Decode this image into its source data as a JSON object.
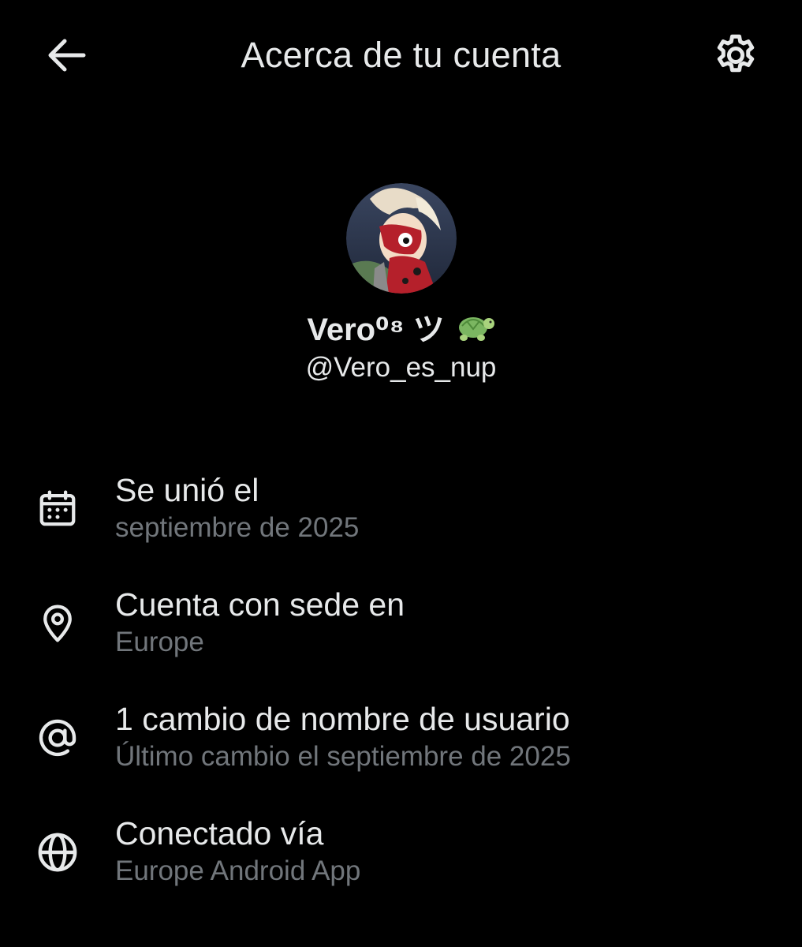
{
  "header": {
    "title": "Acerca de tu cuenta",
    "back_icon": "arrow-left-icon",
    "settings_icon": "gear-icon"
  },
  "profile": {
    "display_name": "Vero⁰⁸ ツ",
    "name_emoji": "turtle-emoji",
    "handle": "@Vero_es_nup"
  },
  "info": [
    {
      "icon": "calendar-icon",
      "title": "Se unió el",
      "subtitle": "septiembre de 2025"
    },
    {
      "icon": "location-pin-icon",
      "title": "Cuenta con sede en",
      "subtitle": "Europe"
    },
    {
      "icon": "at-sign-icon",
      "title": "1 cambio de nombre de usuario",
      "subtitle": "Último cambio el septiembre de 2025"
    },
    {
      "icon": "globe-icon",
      "title": "Conectado vía",
      "subtitle": "Europe Android App"
    }
  ],
  "colors": {
    "background": "#000000",
    "primary_text": "#e7e9ea",
    "secondary_text": "#71767b"
  }
}
